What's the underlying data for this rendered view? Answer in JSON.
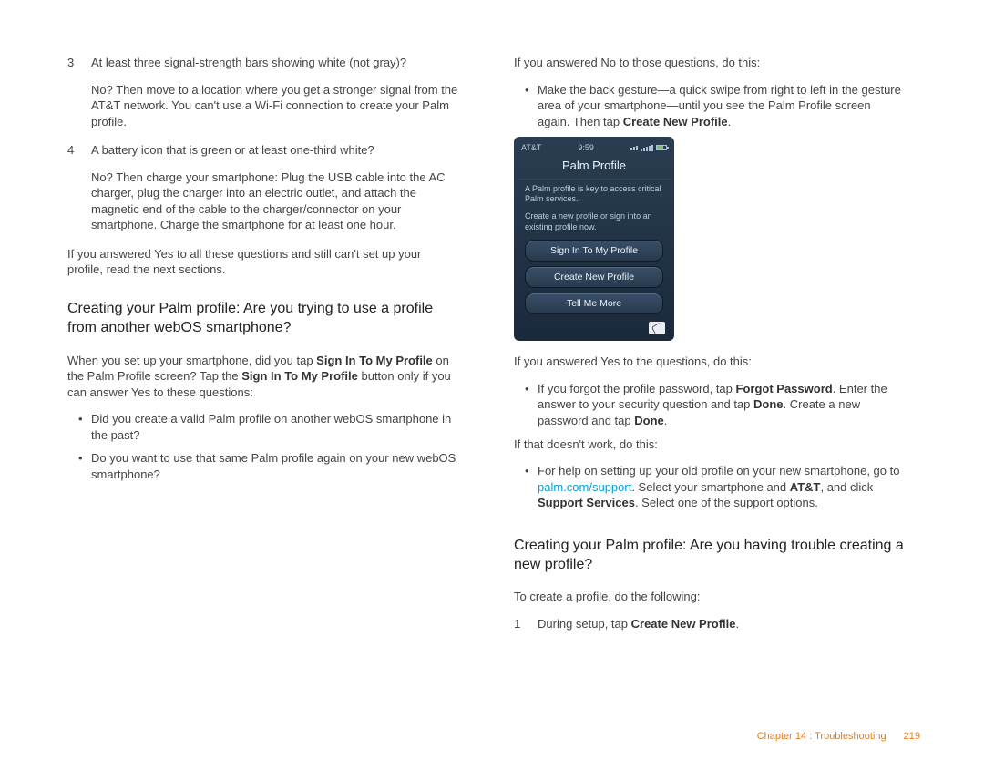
{
  "left": {
    "item3": {
      "num": "3",
      "q": "At least three signal-strength bars showing white (not gray)?",
      "a": "No? Then move to a location where you get a stronger signal from the AT&T network. You can't use a Wi-Fi connection to create your Palm profile."
    },
    "item4": {
      "num": "4",
      "q": "A battery icon that is green or at least one-third white?",
      "a": "No? Then charge your smartphone: Plug the USB cable into the AC charger, plug the charger into an electric outlet, and attach the magnetic end of the cable to the charger/connector on your smartphone. Charge the smartphone for at least one hour."
    },
    "yesAll": "If you answered Yes to all these questions and still can't set up your profile, read the next sections.",
    "h1": "Creating your Palm profile: Are you trying to use a profile from another webOS smartphone?",
    "p1a": "When you set up your smartphone, did you tap ",
    "p1b": "Sign In To My Profile",
    "p1c": " on the Palm Profile screen? Tap the ",
    "p1d": "Sign In To My Profile",
    "p1e": " button only if you can answer Yes to these questions:",
    "b1": "Did you create a valid Palm profile on another webOS smartphone in the past?",
    "b2": "Do you want to use that same Palm profile again on your new webOS smartphone?"
  },
  "right": {
    "noIntro": "If you answered No to those questions, do this:",
    "gesture_a": "Make the back gesture—a quick swipe from right to left in the gesture area of your smartphone—until you see the Palm Profile screen again. Then tap ",
    "gesture_bold": "Create New Profile",
    "gesture_c": ".",
    "phone": {
      "carrier": "AT&T",
      "time": "9:59",
      "title": "Palm Profile",
      "desc1": "A Palm profile is key to access critical Palm services.",
      "desc2": "Create a new profile or sign into an existing profile now.",
      "btn1": "Sign In To My Profile",
      "btn2": "Create New Profile",
      "btn3": "Tell Me More"
    },
    "yesIntro": "If you answered Yes to the questions, do this:",
    "forgot_a": "If you forgot the profile password, tap ",
    "forgot_b": "Forgot Password",
    "forgot_c": ". Enter the answer to your security question and tap ",
    "forgot_d": "Done",
    "forgot_e": ". Create a new password and tap ",
    "forgot_f": "Done",
    "forgot_g": ".",
    "ifFail": "If that doesn't work, do this:",
    "help_a": "For help on setting up your old profile on your new smartphone, go to ",
    "help_link": "palm.com/support",
    "help_b": ". Select your smartphone and ",
    "help_c": "AT&T",
    "help_d": ", and click ",
    "help_e": "Support Services",
    "help_f": ". Select one of the support options.",
    "h2": "Creating your Palm profile: Are you having trouble creating a new profile?",
    "p2": "To create a profile, do the following:",
    "step1n": "1",
    "step1a": "During setup, tap ",
    "step1b": "Create New Profile",
    "step1c": "."
  },
  "footer": {
    "chapter": "Chapter 14 : Troubleshooting",
    "page": "219"
  }
}
